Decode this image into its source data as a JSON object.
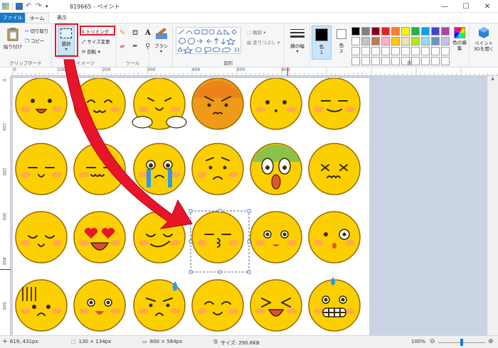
{
  "window": {
    "title": "819665 - ペイント"
  },
  "tabs": {
    "file": "ファイル",
    "home": "ホーム",
    "view": "表示"
  },
  "ribbon": {
    "clipboard": {
      "label": "クリップボード",
      "paste": "貼り付け",
      "cut": "切り取り",
      "copy": "コピー"
    },
    "image": {
      "label": "イメージ",
      "select": "選択",
      "crop": "トリミング",
      "resize": "サイズ変更",
      "rotate": "回転"
    },
    "tools": {
      "label": "ツール"
    },
    "brushes": {
      "label": "ブラシ"
    },
    "shapes": {
      "label": "図形",
      "outline": "輪郭",
      "fill": "塗りつぶし"
    },
    "size": {
      "label": "線の幅"
    },
    "color1": {
      "label": "色",
      "num": "1"
    },
    "color2": {
      "label": "色",
      "num": "2"
    },
    "colors": {
      "label": "色",
      "palette_row1": [
        "#000000",
        "#7f7f7f",
        "#880015",
        "#ed1c24",
        "#ff7f27",
        "#fff200",
        "#22b14c",
        "#00a2e8",
        "#3f48cc",
        "#a349a4"
      ],
      "palette_row2": [
        "#ffffff",
        "#c3c3c3",
        "#b97a57",
        "#ffaec9",
        "#ffc90e",
        "#efe4b0",
        "#b5e61d",
        "#99d9ea",
        "#7092be",
        "#c8bfe7"
      ],
      "edit": "色の編集",
      "color1_value": "#000000",
      "color2_value": "#ffffff"
    },
    "paint3d": {
      "label": "ペイント 3Dを開く"
    }
  },
  "rulers": {
    "top": [
      "0",
      "100",
      "200",
      "300",
      "400",
      "500",
      "600"
    ],
    "left": [
      "0",
      "100",
      "200",
      "300",
      "400",
      "500"
    ]
  },
  "status": {
    "cursor": "619, 431px",
    "selection": "130 × 134px",
    "image_size": "800 × 584px",
    "file_size": "サイズ: 290.6KB",
    "zoom": "100%",
    "zoom_level": 0.5
  },
  "colors": {
    "accent": "#1979ca",
    "highlight": "#e8152a",
    "emoji": "#fcd000",
    "emoji_outline": "#9a6b00",
    "workspace": "#c9d3e2"
  }
}
